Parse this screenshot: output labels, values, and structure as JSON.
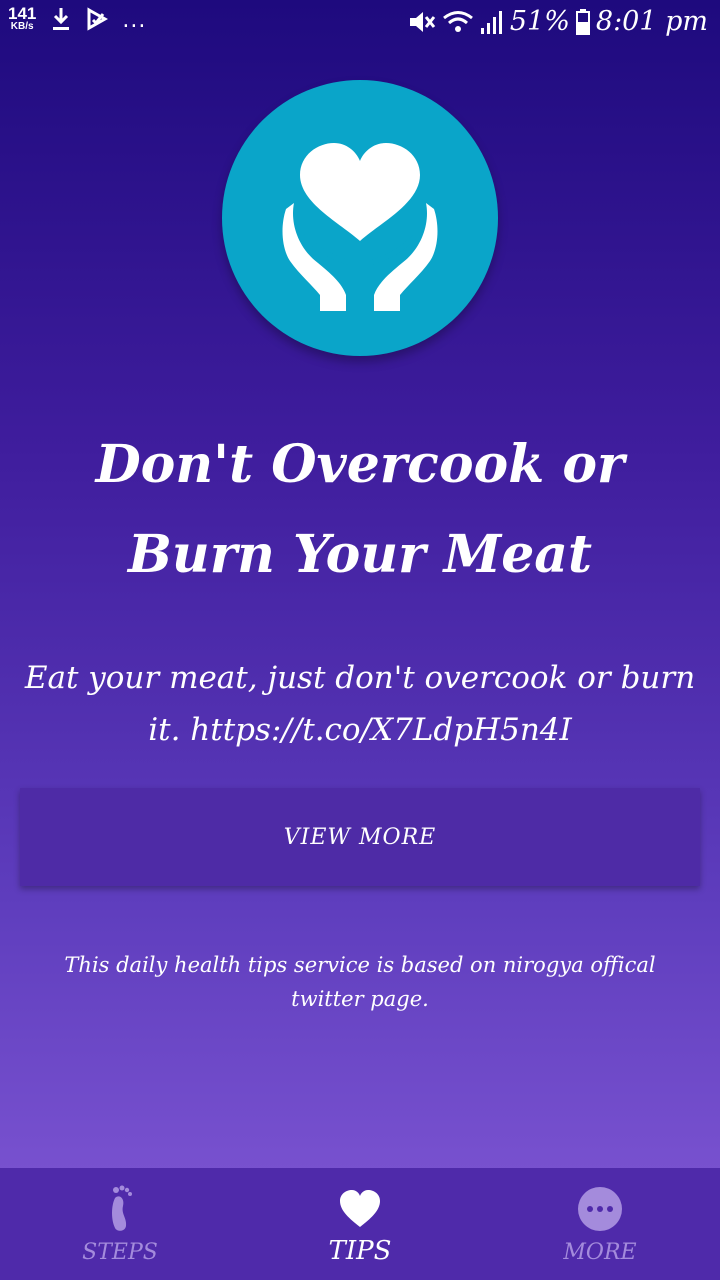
{
  "status_bar": {
    "net_speed": "141",
    "net_speed_unit": "KB/s",
    "more_indicator": "...",
    "battery": "51%",
    "time": "8:01 pm",
    "icons": [
      "download-icon",
      "play-store-icon",
      "mute-icon",
      "wifi-icon",
      "signal-icon",
      "battery-icon"
    ]
  },
  "logo": {
    "icon": "heart-hands-icon",
    "bg_color": "#0aa5c9"
  },
  "tip": {
    "title": "Don't Overcook or Burn Your Meat",
    "description": "Eat your meat, just don't overcook or burn it. https://t.co/X7LdpH5n4I",
    "view_more_label": "VIEW MORE"
  },
  "footnote": "This daily health tips service is based on nirogya offical twitter page.",
  "bottom_nav": {
    "items": [
      {
        "label": "STEPS",
        "icon": "footprint-icon",
        "active": false
      },
      {
        "label": "TIPS",
        "icon": "heart-icon",
        "active": true
      },
      {
        "label": "MORE",
        "icon": "more-dots-icon",
        "active": false
      }
    ]
  },
  "colors": {
    "accent": "#4f2aaa",
    "active": "#ffffff",
    "inactive": "#a48bdc"
  }
}
